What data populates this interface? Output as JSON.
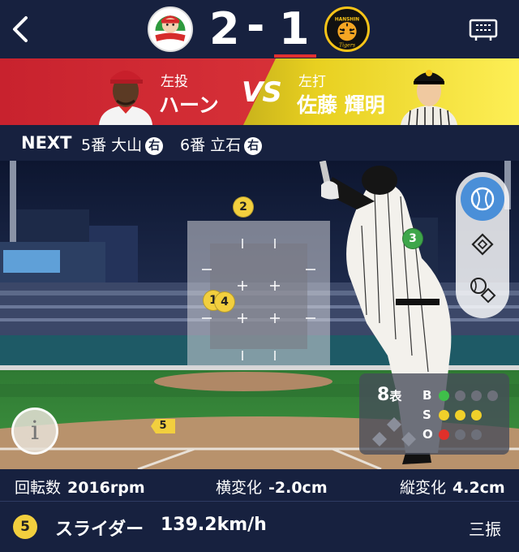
{
  "header": {
    "home_team": "Carp",
    "away_team": "Tigers",
    "away_logo_text": "HANSHIN",
    "home_score": "2",
    "separator": "-",
    "away_score": "1"
  },
  "matchup": {
    "pitcher_role": "左投",
    "pitcher_name": "ハーン",
    "vs": "VS",
    "batter_role": "左打",
    "batter_name": "佐藤 輝明"
  },
  "next": {
    "label": "NEXT",
    "batters": [
      {
        "text": "5番 大山",
        "hand": "右"
      },
      {
        "text": "6番 立石",
        "hand": "右"
      }
    ]
  },
  "pitch_markers": [
    "2",
    "3",
    "1",
    "4",
    "5"
  ],
  "count": {
    "inning": "8",
    "half": "表",
    "labels": [
      "B",
      "S",
      "O"
    ],
    "balls": 1,
    "strikes": 3,
    "outs": 1
  },
  "stats": {
    "spin_label": "回転数",
    "spin_value": "2016rpm",
    "h_label": "横変化",
    "h_value": "-2.0cm",
    "v_label": "縦変化",
    "v_value": "4.2cm"
  },
  "pitch": {
    "number": "5",
    "type": "スライダー",
    "speed": "139.2km/h",
    "result": "三振"
  },
  "colors": {
    "navy": "#17213f",
    "carp_red": "#d73138",
    "tigers_yellow": "#f2de2a",
    "active_blue": "#4a8fd8"
  }
}
